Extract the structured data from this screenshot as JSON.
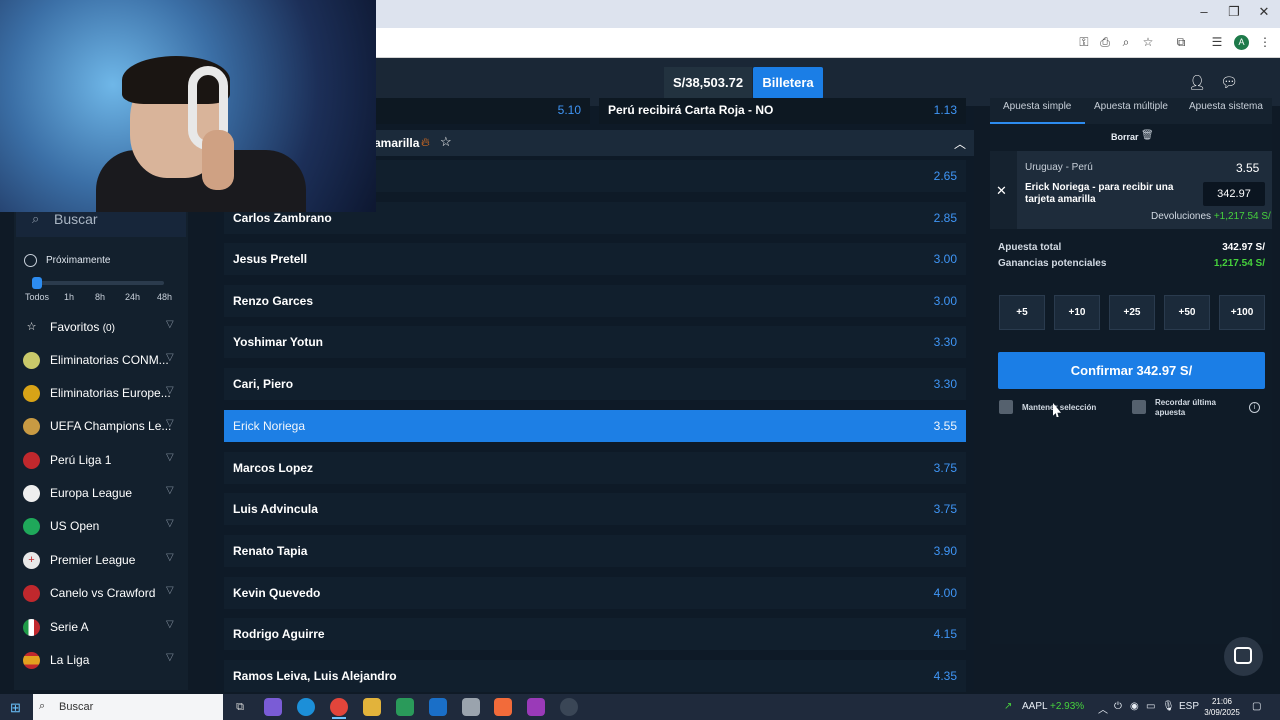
{
  "browser": {
    "window_controls": [
      "–",
      "❐",
      "✕"
    ],
    "icons": [
      "key-icon",
      "install-icon",
      "zoom-icon",
      "star-icon",
      "extensions-icon",
      "reading-list-icon",
      "profile-icon",
      "menu-icon"
    ],
    "profile_initial": "A"
  },
  "header": {
    "balance": "S/38,503.72",
    "wallet_label": "Billetera"
  },
  "sidebar": {
    "search_placeholder": "Buscar",
    "soon_label": "Próximamente",
    "time_filters": [
      "Todos",
      "1h",
      "8h",
      "24h",
      "48h"
    ],
    "slider_value_fraction": 0,
    "leagues": [
      {
        "label": "Favoritos",
        "count": "(0)",
        "icon": "star-icon",
        "color": "#13202d"
      },
      {
        "label": "Eliminatorias CONM...",
        "icon": "ball-icon",
        "color": "#c9c96a"
      },
      {
        "label": "Eliminatorias Europe...",
        "icon": "ball-icon",
        "color": "#d8a317"
      },
      {
        "label": "UEFA Champions Le...",
        "icon": "ball-icon",
        "color": "#c89a43"
      },
      {
        "label": "Perú Liga 1",
        "icon": "flag-icon",
        "color": "#c0282d"
      },
      {
        "label": "Europa League",
        "icon": "ball-icon",
        "color": "#eeeeee"
      },
      {
        "label": "US Open",
        "icon": "tennis-icon",
        "color": "#1fa85a"
      },
      {
        "label": "Premier League",
        "icon": "flag-icon",
        "color": "#e8e8e8"
      },
      {
        "label": "Canelo vs Crawford",
        "icon": "flag-icon",
        "color": "#c0282d"
      },
      {
        "label": "Serie A",
        "icon": "flag-icon",
        "color": "#1f9a47"
      },
      {
        "label": "La Liga",
        "icon": "flag-icon",
        "color": "#e2a11f"
      }
    ]
  },
  "main": {
    "top_row": {
      "left_odd": "5.10",
      "right_label": "Perú recibirá Carta Roja - NO",
      "right_odd": "1.13"
    },
    "section_title": "amarilla",
    "players": [
      {
        "name": "",
        "odd": "2.65"
      },
      {
        "name": "Carlos Zambrano",
        "odd": "2.85"
      },
      {
        "name": "Jesus Pretell",
        "odd": "3.00"
      },
      {
        "name": "Renzo Garces",
        "odd": "3.00"
      },
      {
        "name": "Yoshimar Yotun",
        "odd": "3.30"
      },
      {
        "name": "Cari, Piero",
        "odd": "3.30"
      },
      {
        "name": "Erick Noriega",
        "odd": "3.55",
        "selected": true
      },
      {
        "name": "Marcos Lopez",
        "odd": "3.75"
      },
      {
        "name": "Luis Advincula",
        "odd": "3.75"
      },
      {
        "name": "Renato Tapia",
        "odd": "3.90"
      },
      {
        "name": "Kevin Quevedo",
        "odd": "4.00"
      },
      {
        "name": "Rodrigo Aguirre",
        "odd": "4.15"
      },
      {
        "name": "Ramos Leiva, Luis Alejandro",
        "odd": "4.35"
      }
    ]
  },
  "slip": {
    "tabs": [
      "Apuesta simple",
      "Apuesta múltiple",
      "Apuesta sistema"
    ],
    "clear_label": "Borrar",
    "match": "Uruguay - Perú",
    "odd": "3.55",
    "selection": "Erick Noriega - para recibir una tarjeta amarilla",
    "stake": "342.97",
    "returns_label": "Devoluciones",
    "returns_value": "+1,217.54 S/",
    "total_label": "Apuesta total",
    "total_value": "342.97 S/",
    "potential_label": "Ganancias potenciales",
    "potential_value": "1,217.54 S/",
    "quick_stakes": [
      "+5",
      "+10",
      "+25",
      "+50",
      "+100"
    ],
    "confirm_label": "Confirmar 342.97 S/",
    "keep_selection_label": "Mantener selección",
    "remember_last_label": "Recordar última apuesta"
  },
  "taskbar": {
    "search_placeholder": "Buscar",
    "ticker": "AAPL",
    "ticker_change": "+2.93%",
    "language": "ESP",
    "time": "21:06",
    "date": "3/09/2025"
  }
}
